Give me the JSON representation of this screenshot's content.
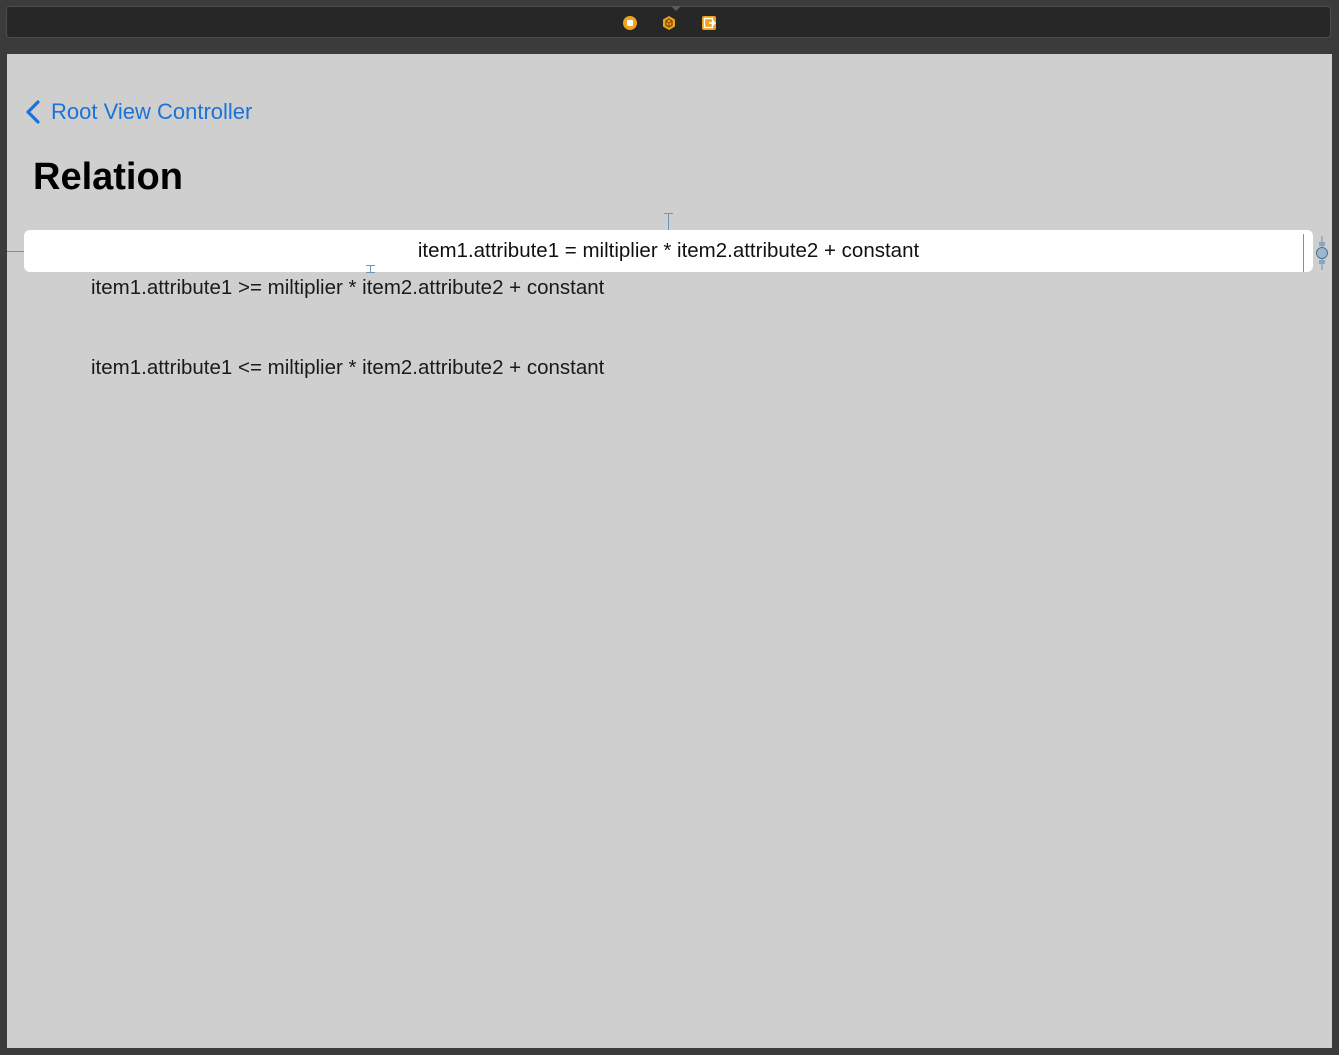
{
  "scene_bar": {
    "icons": [
      {
        "name": "view-controller-icon",
        "color": "#f0a21e"
      },
      {
        "name": "first-responder-icon",
        "color": "#f0a21e"
      },
      {
        "name": "exit-icon",
        "color": "#f0a21e"
      }
    ]
  },
  "navigation": {
    "back_label": "Root View Controller",
    "title": "Relation"
  },
  "labels": {
    "equal": "item1.attribute1 = miltiplier * item2.attribute2 + constant",
    "greater_or_equal": "item1.attribute1 >= miltiplier * item2.attribute2 + constant",
    "less_or_equal": "item1.attribute1 <= miltiplier * item2.attribute2 + constant"
  },
  "colors": {
    "accent": "#1a73d9",
    "canvas_background": "#cfcfcf",
    "selection_background": "#ffffff",
    "constraint_guide": "#6f94b6"
  }
}
